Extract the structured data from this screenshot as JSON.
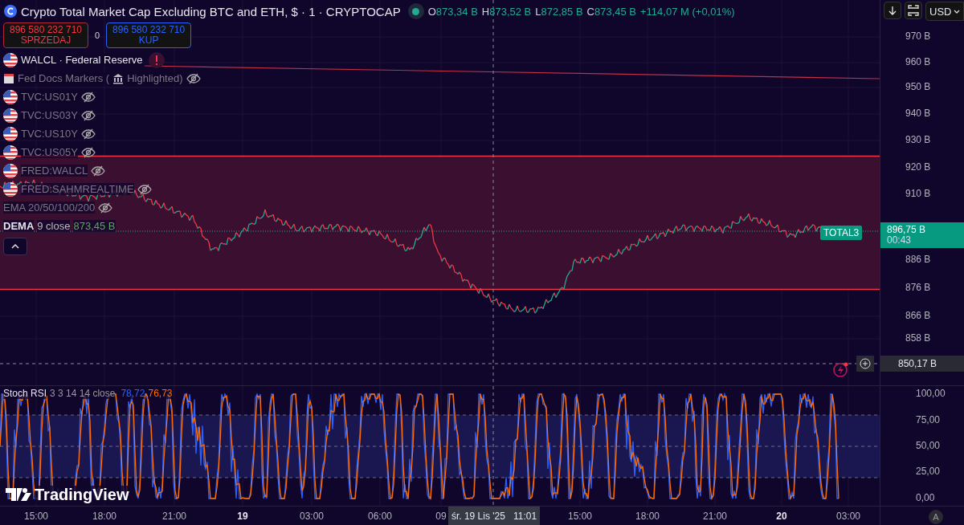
{
  "header": {
    "title": "Crypto Total Market Cap Excluding BTC and ETH, $ · 1 · CRYPTOCAP",
    "market_open": true,
    "ohlc": [
      {
        "key": "O",
        "value": "873,34 B"
      },
      {
        "key": "H",
        "value": "873,52 B"
      },
      {
        "key": "L",
        "value": "872,85 B"
      },
      {
        "key": "C",
        "value": "873,45 B"
      }
    ],
    "change": "+114,07 M (+0,01%)"
  },
  "toolbar": {
    "currency": "USD"
  },
  "trade": {
    "sell": {
      "price": "896 580 232 710",
      "label": "SPRZEDAJ"
    },
    "spread": "0",
    "buy": {
      "price": "896 580 232 710",
      "label": "KUP"
    }
  },
  "legend": [
    {
      "kind": "series",
      "name": "WALCL · Federal Reserve",
      "hidden": false,
      "warning": true
    },
    {
      "kind": "markers",
      "name": "Fed Docs Markers (",
      "suffix": "Highlighted)",
      "hidden": true
    },
    {
      "kind": "series",
      "name": "TVC:US01Y",
      "hidden": true,
      "warning": false
    },
    {
      "kind": "series",
      "name": "TVC:US03Y",
      "hidden": true,
      "warning": false
    },
    {
      "kind": "series",
      "name": "TVC:US10Y",
      "hidden": true,
      "warning": false
    },
    {
      "kind": "series",
      "name": "TVC:US05Y",
      "hidden": true,
      "warning": false
    },
    {
      "kind": "series",
      "name": "FRED:WALCL",
      "hidden": true,
      "warning": false
    },
    {
      "kind": "series",
      "name": "FRED:SAHMREALTIME",
      "hidden": true,
      "warning": false
    },
    {
      "kind": "indicator",
      "name": "EMA 20/50/100/200",
      "hidden": true
    },
    {
      "kind": "indicator",
      "name": "DEMA",
      "params": "9 close",
      "value": "873,45 B",
      "hidden": false
    }
  ],
  "price_axis": [
    "970 B",
    "960 B",
    "950 B",
    "940 B",
    "930 B",
    "920 B",
    "910 B",
    "886 B",
    "876 B",
    "866 B",
    "858 B"
  ],
  "last_price": {
    "symbol": "TOTAL3",
    "price": "896,75 B",
    "countdown": "00:43"
  },
  "crosshair": {
    "price": "850,17 B",
    "date": "śr. 19 Lis '25",
    "time": "11:01"
  },
  "rsi": {
    "name": "Stoch RSI",
    "params": "3 3 14 14 close",
    "k": "78,72",
    "d": "76,73",
    "axis": [
      "100,00",
      "75,00",
      "50,00",
      "25,00",
      "0,00"
    ]
  },
  "logo": "TradingView",
  "time_axis": [
    {
      "label": "15:00",
      "bold": false
    },
    {
      "label": "18:00",
      "bold": false
    },
    {
      "label": "21:00",
      "bold": false
    },
    {
      "label": "19",
      "bold": true
    },
    {
      "label": "03:00",
      "bold": false
    },
    {
      "label": "06:00",
      "bold": false
    },
    {
      "label": "09",
      "bold": false
    },
    {
      "label": "15:00",
      "bold": false
    },
    {
      "label": "18:00",
      "bold": false
    },
    {
      "label": "21:00",
      "bold": false
    },
    {
      "label": "20",
      "bold": true
    },
    {
      "label": "03:00",
      "bold": false
    }
  ],
  "auto_scale": "A"
}
